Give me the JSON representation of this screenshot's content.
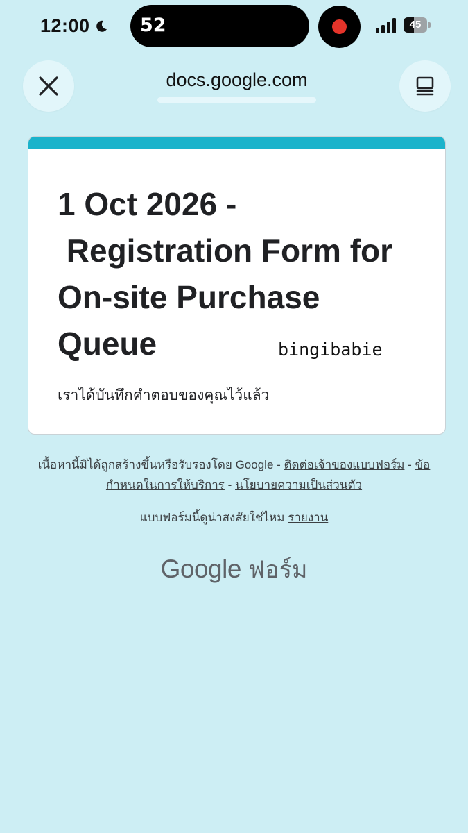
{
  "status_bar": {
    "time": "12:00",
    "island_counter": "52",
    "battery_level": "45",
    "battery_fraction": 0.45
  },
  "browser": {
    "url": "docs.google.com",
    "icons": {
      "close": "close-icon",
      "tabs": "tab-switcher-icon"
    }
  },
  "form": {
    "title": "1 Oct 2026 -\n Registration Form for On-site Purchase Queue",
    "watermark": "bingibabie",
    "confirmation": "เราได้บันทึกคำตอบของคุณไว้แล้ว",
    "accent_color": "#1bb3cb"
  },
  "footer": {
    "disclaimer_prefix": "เนื้อหานี้มิได้ถูกสร้างขึ้นหรือรับรองโดย Google - ",
    "contact_owner_link": "ติดต่อเจ้าของแบบฟอร์ม",
    "separator": " - ",
    "terms_link": "ข้อกำหนดในการให้บริการ",
    "privacy_link": "นโยบายความเป็นส่วนตัว",
    "suspicious_text": "แบบฟอร์มนี้ดูน่าสงสัยใช่ไหม ",
    "report_link": "รายงาน",
    "brand_google": "Google",
    "brand_product": "ฟอร์ม"
  }
}
